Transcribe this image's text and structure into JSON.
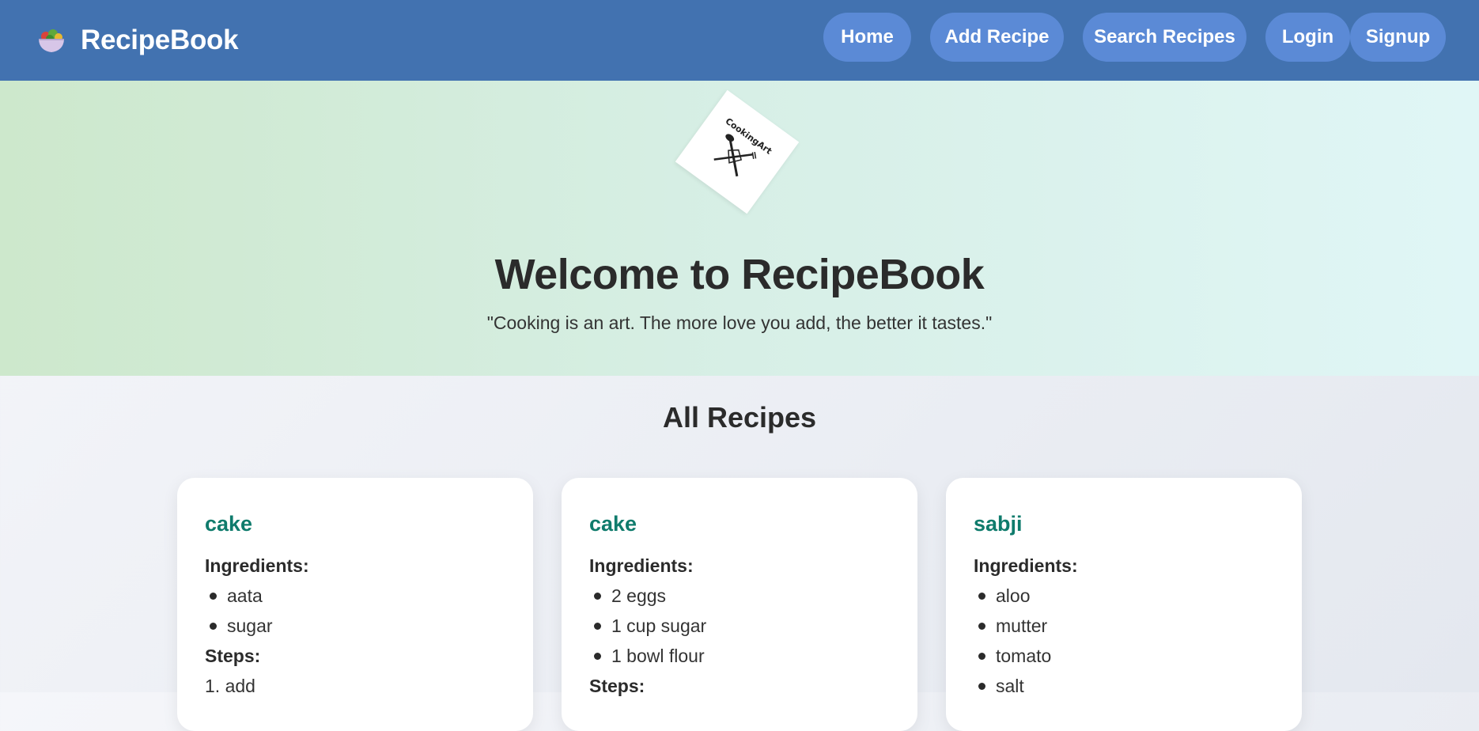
{
  "navbar": {
    "brand_icon": "salad-bowl-icon",
    "brand_title": "RecipeBook",
    "links": {
      "home": "Home",
      "add_recipe": "Add Recipe",
      "search_recipes": "Search Recipes",
      "login": "Login",
      "signup": "Signup"
    }
  },
  "hero": {
    "logo_icon": "cookingart-logo",
    "logo_text": "CookingArt",
    "title": "Welcome to RecipeBook",
    "quote": "\"Cooking is an art. The more love you add, the better it tastes.\""
  },
  "recipes": {
    "section_title": "All Recipes",
    "ingredients_label": "Ingredients:",
    "steps_label": "Steps:",
    "items": [
      {
        "title": "cake",
        "ingredients": [
          "aata",
          "sugar"
        ],
        "steps": [
          "1. add"
        ]
      },
      {
        "title": "cake",
        "ingredients": [
          "2 eggs",
          "1 cup sugar",
          "1 bowl flour"
        ],
        "steps": []
      },
      {
        "title": "sabji",
        "ingredients": [
          "aloo",
          "mutter",
          "tomato",
          "salt"
        ],
        "steps": []
      }
    ]
  },
  "colors": {
    "navbar": "#4272b0",
    "nav_button": "#5b8ad6",
    "recipe_title": "#0f7b6c"
  }
}
